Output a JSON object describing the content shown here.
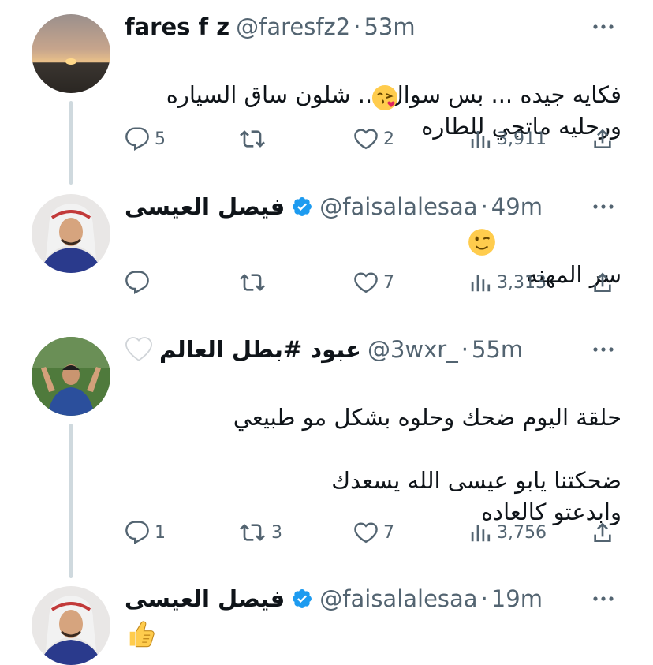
{
  "tweets": [
    {
      "name": "fares f z",
      "handle": "@faresfz2",
      "sep": "·",
      "time": "53m",
      "text": "فكايه جيده ... بس سوال ... شلون ساق السياره\nورحليه ماتجي للطاره",
      "text_emoji": "face-blowing-kiss",
      "replies": "5",
      "retweets": "",
      "likes": "2",
      "views": "3,911"
    },
    {
      "name": "فيصل العيسى",
      "handle": "@faisalalesaa",
      "sep": "·",
      "time": "49m",
      "verified": true,
      "text": "سر المهنه",
      "text_emoji": "winking-face",
      "replies": "",
      "retweets": "",
      "likes": "7",
      "views": "3,313"
    },
    {
      "name": "عبود #بطل العالم",
      "handle": "@3wxr_",
      "sep": "·",
      "time": "55m",
      "name_emoji": "white-heart",
      "text": "حلقة اليوم ضحك وحلوه بشكل مو طبيعي\n\nضحكتنا يابو عيسى الله يسعدك\nوابدعتو كالعاده",
      "replies": "1",
      "retweets": "3",
      "likes": "7",
      "views": "3,756"
    },
    {
      "name": "فيصل العيسى",
      "handle": "@faisalalesaa",
      "sep": "·",
      "time": "19m",
      "verified": true,
      "text": "",
      "text_emoji": "thumbs-up"
    }
  ],
  "colors": {
    "text": "#0f1419",
    "secondary": "#536471",
    "verified": "#1d9bf0",
    "thread_line": "#cfd9de",
    "divider": "#eff3f4"
  }
}
